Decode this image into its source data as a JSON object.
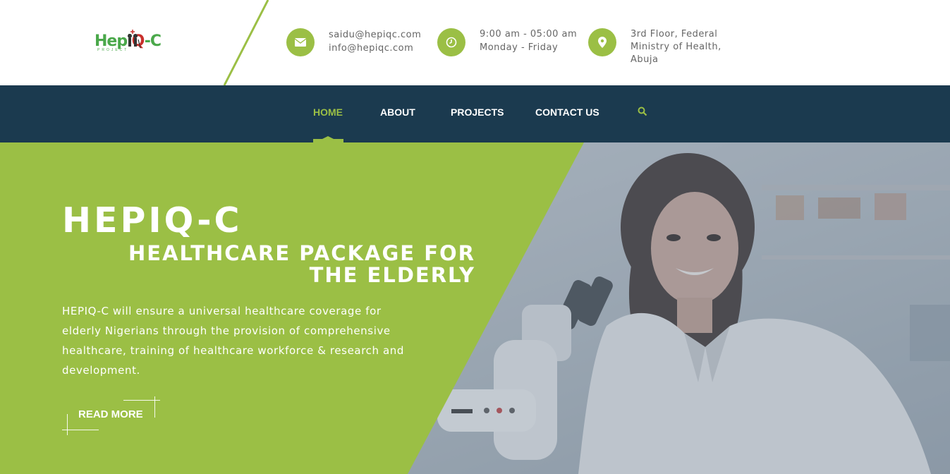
{
  "brand": {
    "logo_part1": "Hepi",
    "logo_part2": "Q",
    "logo_part3": "-C",
    "logo_sub": "PROJECT",
    "primary_color": "#9bbf45",
    "nav_color": "#1b3a4f",
    "logo_red": "#c9302c"
  },
  "contact": {
    "email_icon": "envelope-icon",
    "email_line1": "saidu@hepiqc.com",
    "email_line2": "info@hepiqc.com",
    "hours_icon": "clock-icon",
    "hours_line1": "9:00 am - 05:00 am",
    "hours_line2": "Monday - Friday",
    "address_icon": "map-marker-icon",
    "address_line1": "3rd Floor, Federal",
    "address_line2": "Ministry of Health,",
    "address_line3": "Abuja"
  },
  "nav": {
    "items": [
      {
        "label": "HOME",
        "active": true
      },
      {
        "label": "ABOUT",
        "active": false
      },
      {
        "label": "PROJECTS",
        "active": false
      },
      {
        "label": "CONTACT US",
        "active": false
      }
    ],
    "search_icon": "search-icon"
  },
  "hero": {
    "title": "HEPIQ-C",
    "subtitle": "HEALTHCARE PACKAGE FOR THE ELDERLY",
    "description": "HEPIQ-C will ensure a universal healthcare coverage for elderly Nigerians through the provision of comprehensive healthcare, training of healthcare workforce & research and development.",
    "button_label": "READ MORE"
  }
}
